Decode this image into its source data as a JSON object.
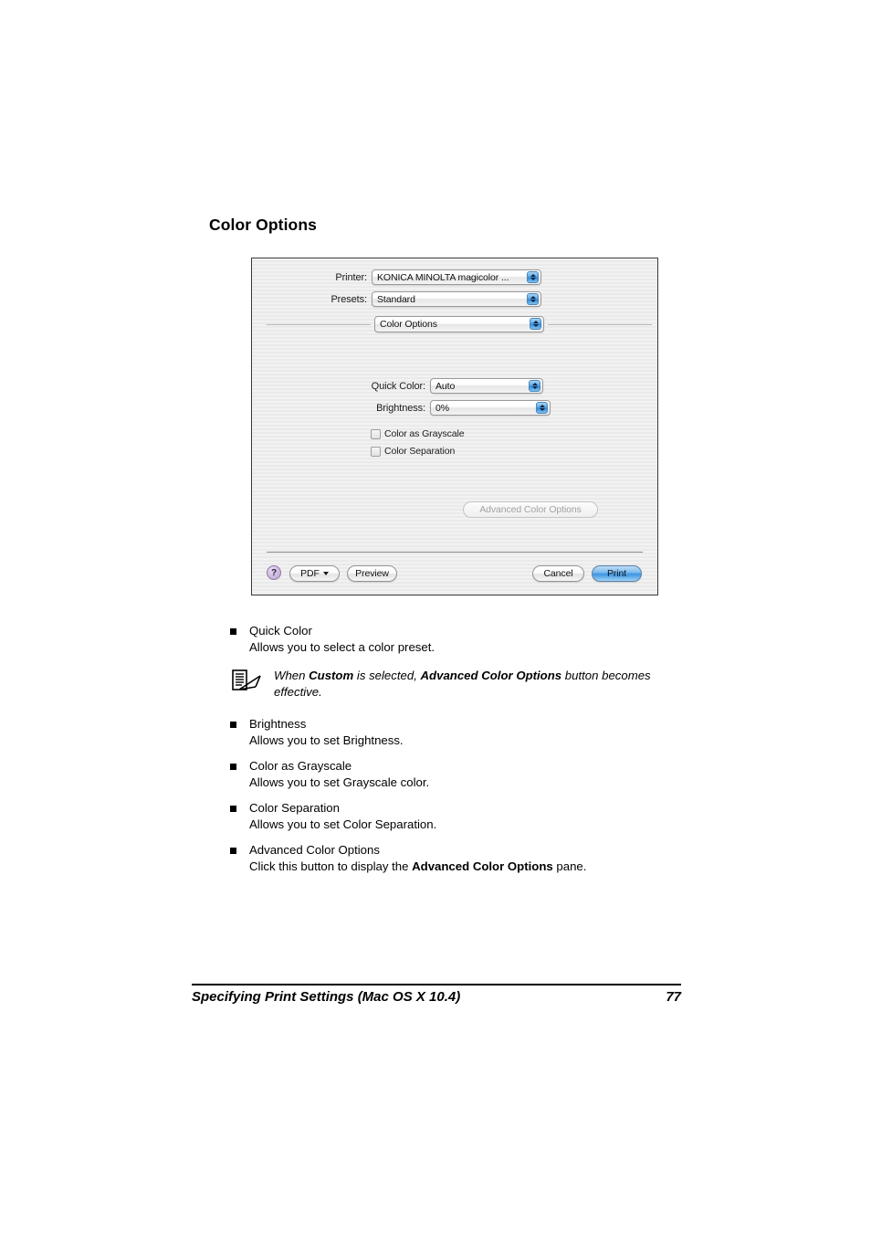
{
  "page": {
    "heading": "Color Options"
  },
  "dialog": {
    "printer": {
      "label": "Printer:",
      "value": "KONICA MINOLTA magicolor ..."
    },
    "presets": {
      "label": "Presets:",
      "value": "Standard"
    },
    "pane": {
      "value": "Color Options"
    },
    "quick_color": {
      "label": "Quick Color:",
      "value": "Auto"
    },
    "brightness": {
      "label": "Brightness:",
      "value": "0%"
    },
    "checkboxes": [
      {
        "label": "Color as Grayscale",
        "checked": false
      },
      {
        "label": "Color Separation",
        "checked": false
      }
    ],
    "advanced_button": {
      "label": "Advanced Color Options",
      "enabled": false
    },
    "buttons": {
      "help": "?",
      "pdf": "PDF",
      "preview": "Preview",
      "cancel": "Cancel",
      "print": "Print"
    },
    "colors": {
      "popup_arrow_blue": "#2e86d8",
      "print_button_blue": "#3d95e2",
      "help_button_purple": "#b9a3d4",
      "disabled_text": "#a2a2a2"
    }
  },
  "body": {
    "items": [
      {
        "title": "Quick Color",
        "desc": "Allows you to select a color preset."
      },
      {
        "title": "Brightness",
        "desc": "Allows you to set Brightness."
      },
      {
        "title": "Color as Grayscale",
        "desc": "Allows you to set Grayscale color."
      },
      {
        "title": "Color Separation",
        "desc": "Allows you to set Color Separation."
      },
      {
        "title": "Advanced Color Options",
        "desc_pre": "Click this button to display the ",
        "desc_bold": "Advanced Color Options",
        "desc_post": " pane."
      }
    ],
    "note": {
      "pre": "When ",
      "bold1": "Custom",
      "mid": " is selected, ",
      "bold2": "Advanced Color Options",
      "post": " button becomes effective."
    }
  },
  "footer": {
    "title": "Specifying Print Settings (Mac OS X 10.4)",
    "page_number": "77"
  }
}
